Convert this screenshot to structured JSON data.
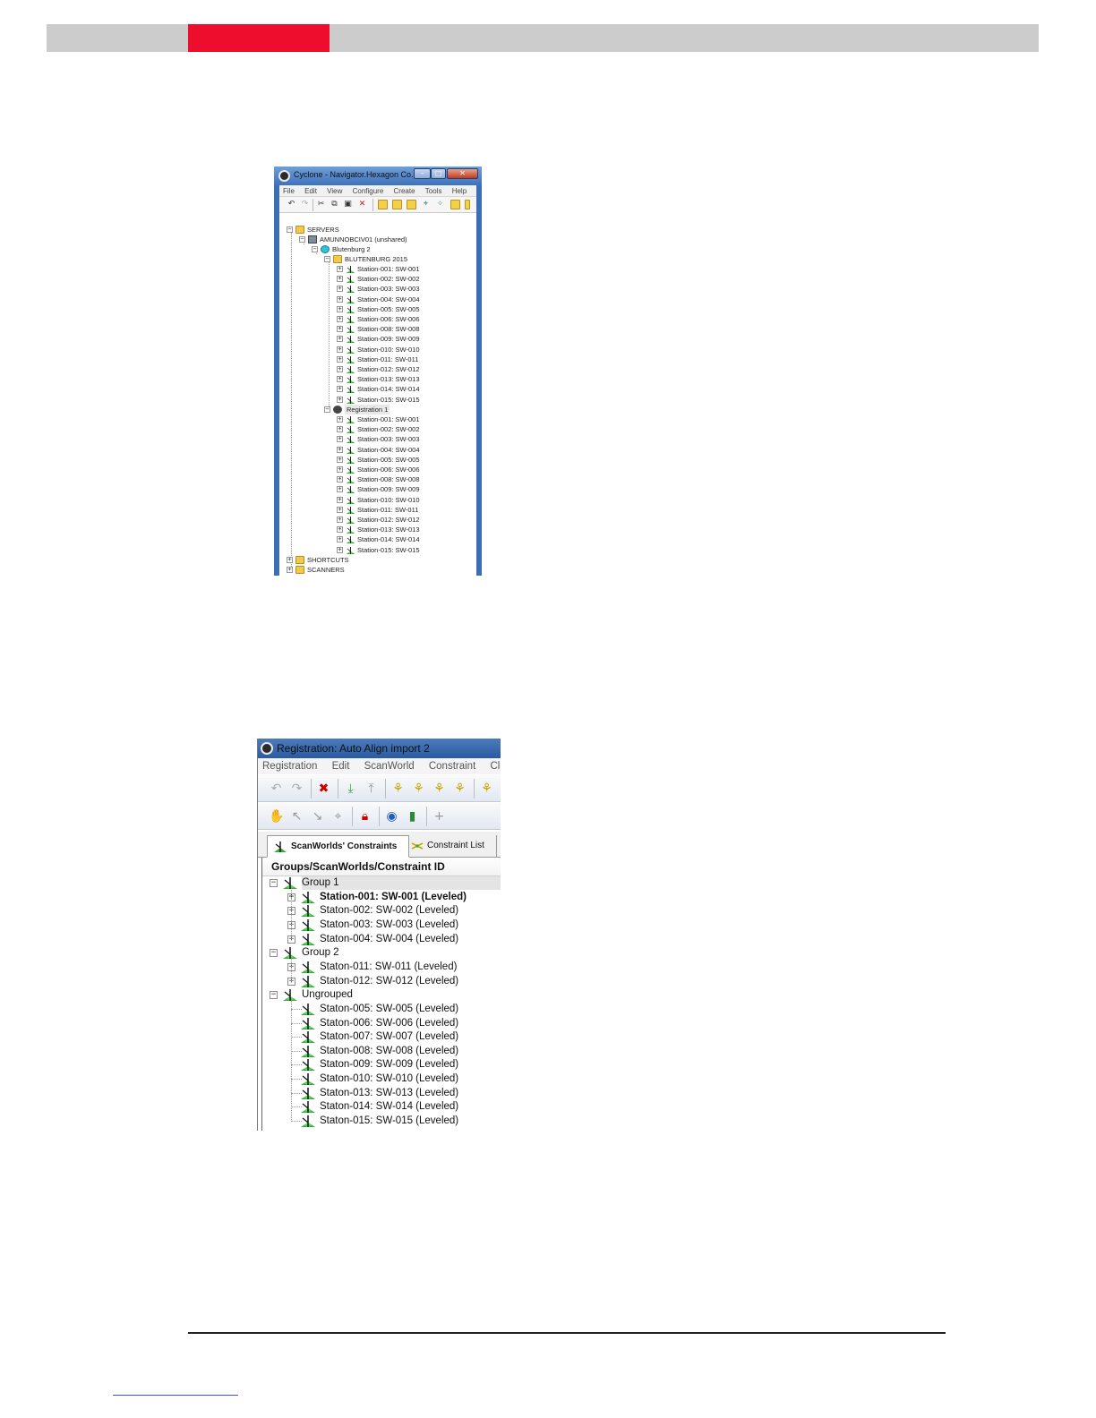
{
  "colors": {
    "band_grey": "#cccccc",
    "band_red": "#ee0d2d",
    "station_icon_green": "#2fae2f"
  },
  "navigator": {
    "title": "Cyclone - Navigator.Hexagon Co...",
    "window_buttons": [
      "minimize",
      "maximize",
      "close"
    ],
    "menu": [
      "File",
      "Edit",
      "View",
      "Configure",
      "Create",
      "Tools",
      "Help"
    ],
    "tree": {
      "servers": "SERVERS",
      "server_name": "AMUNNOBCIV01 (unshared)",
      "database": "Blutenburg 2",
      "project": "BLUTENBURG 2015",
      "project_stations": [
        "Station-001: SW-001",
        "Station-002: SW-002",
        "Station-003: SW-003",
        "Station-004: SW-004",
        "Station-005: SW-005",
        "Station-006: SW-006",
        "Station-008: SW-008",
        "Station-009: SW-009",
        "Station-010: SW-010",
        "Station-011: SW-011",
        "Station-012: SW-012",
        "Station-013: SW-013",
        "Station-014: SW-014",
        "Station-015: SW-015"
      ],
      "registration": "Registration 1",
      "registration_stations": [
        "Station-001: SW-001",
        "Station-002: SW-002",
        "Station-003: SW-003",
        "Station-004: SW-004",
        "Station-005: SW-005",
        "Station-006: SW-006",
        "Station-008: SW-008",
        "Station-009: SW-009",
        "Station-010: SW-010",
        "Station-011: SW-011",
        "Station-012: SW-012",
        "Station-013: SW-013",
        "Station-014: SW-014",
        "Station-015: SW-015"
      ],
      "shortcuts": "SHORTCUTS",
      "scanners": "SCANNERS"
    }
  },
  "registration": {
    "title": "Registration: Auto Align import 2",
    "menu": [
      "Registration",
      "Edit",
      "ScanWorld",
      "Constraint",
      "Clo"
    ],
    "tabs": {
      "scanworlds_constraints": "ScanWorlds' Constraints",
      "constraint_list": "Constraint List"
    },
    "tree_header": "Groups/ScanWorlds/Constraint ID",
    "groups": [
      {
        "name": "Group 1",
        "items": [
          "Station-001: SW-001 (Leveled)",
          "Staton-002: SW-002 (Leveled)",
          "Staton-003: SW-003 (Leveled)",
          "Staton-004: SW-004 (Leveled)"
        ]
      },
      {
        "name": "Group 2",
        "items": [
          "Staton-011: SW-011 (Leveled)",
          "Staton-012: SW-012 (Leveled)"
        ]
      },
      {
        "name": "Ungrouped",
        "items": [
          "Staton-005: SW-005 (Leveled)",
          "Staton-006: SW-006 (Leveled)",
          "Staton-007: SW-007 (Leveled)",
          "Staton-008: SW-008 (Leveled)",
          "Staton-009: SW-009 (Leveled)",
          "Staton-010: SW-010 (Leveled)",
          "Staton-013: SW-013 (Leveled)",
          "Staton-014: SW-014 (Leveled)",
          "Staton-015: SW-015 (Leveled)"
        ]
      }
    ]
  }
}
